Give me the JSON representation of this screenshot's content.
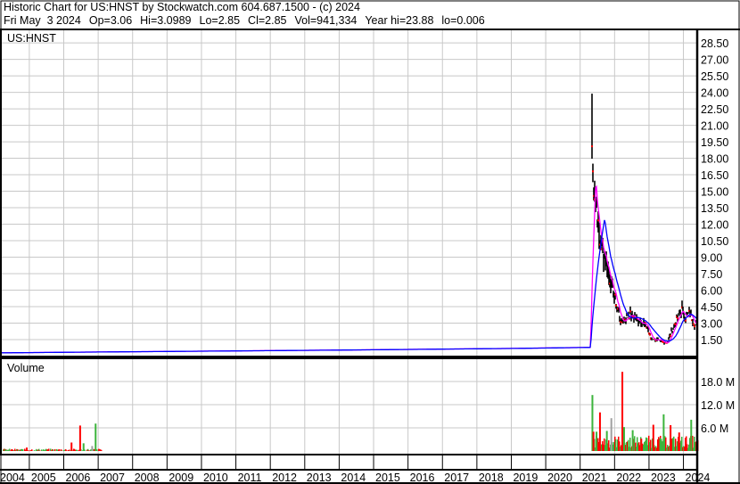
{
  "header": {
    "title": "Historic Chart for US:HNST by Stockwatch.com 604.687.1500 - (c) 2024",
    "date": "Fri May  3 2024",
    "open": "Op=3.06",
    "high": "Hi=3.0989",
    "low": "Lo=2.85",
    "close": "Cl=2.85",
    "volume": "Vol=941,334",
    "year_high": "Year hi=23.88",
    "year_low": "lo=0.006"
  },
  "chart_data": {
    "type": "line",
    "title": "Historic Chart for US:HNST",
    "symbol_label": "US:HNST",
    "volume_label": "Volume",
    "x_ticks": [
      "2004",
      "2005",
      "2006",
      "2007",
      "2008",
      "2009",
      "2010",
      "2011",
      "2012",
      "2013",
      "2014",
      "2015",
      "2016",
      "2017",
      "2018",
      "2019",
      "2020",
      "2021",
      "2022",
      "2023",
      "2024"
    ],
    "xlim": [
      2004.2,
      2024.4
    ],
    "price_ticks": [
      "1.50",
      "3.00",
      "4.50",
      "6.00",
      "7.50",
      "9.00",
      "10.50",
      "12.00",
      "13.50",
      "15.00",
      "16.50",
      "18.00",
      "19.50",
      "21.00",
      "22.50",
      "24.00",
      "25.50",
      "27.00",
      "28.50"
    ],
    "price_ylim": [
      0,
      29.5
    ],
    "volume_ticks": [
      "6.0 M",
      "12.0 M",
      "18.0 M"
    ],
    "volume_ylim_millions": [
      0,
      24
    ],
    "colors": {
      "price_bar": "#000000",
      "price_mark": "#ff0000",
      "ma_short": "#ff00ff",
      "ma_long": "#0000ff",
      "vol_up": "#3cb43c",
      "vol_down": "#ff0000",
      "vol_flat": "#a0a0a0",
      "grid": "#c8c8c8"
    },
    "price_close_series": [
      [
        2004.2,
        0.3
      ],
      [
        2006,
        0.35
      ],
      [
        2008,
        0.4
      ],
      [
        2010,
        0.45
      ],
      [
        2014,
        0.55
      ],
      [
        2019,
        0.7
      ],
      [
        2021.3,
        0.8
      ],
      [
        2021.33,
        21
      ],
      [
        2021.36,
        17
      ],
      [
        2021.4,
        15.5
      ],
      [
        2021.48,
        13.5
      ],
      [
        2021.55,
        10.5
      ],
      [
        2021.62,
        10
      ],
      [
        2021.75,
        8.5
      ],
      [
        2021.9,
        6.5
      ],
      [
        2022.05,
        4.8
      ],
      [
        2022.2,
        3.0
      ],
      [
        2022.3,
        3.4
      ],
      [
        2022.45,
        3.8
      ],
      [
        2022.6,
        3.4
      ],
      [
        2022.8,
        3.1
      ],
      [
        2022.95,
        2.6
      ],
      [
        2023.05,
        1.6
      ],
      [
        2023.3,
        1.4
      ],
      [
        2023.45,
        1.2
      ],
      [
        2023.55,
        1.3
      ],
      [
        2023.7,
        2.6
      ],
      [
        2023.85,
        3.6
      ],
      [
        2023.95,
        4.3
      ],
      [
        2024.05,
        3.4
      ],
      [
        2024.18,
        3.9
      ],
      [
        2024.34,
        2.85
      ]
    ],
    "price_high": 23.88,
    "volume_millions": [
      [
        2004.3,
        0.3,
        "up"
      ],
      [
        2004.9,
        0.9,
        "down"
      ],
      [
        2005.5,
        0.4,
        "down"
      ],
      [
        2006.2,
        2.2,
        "down"
      ],
      [
        2006.45,
        6.6,
        "down"
      ],
      [
        2006.55,
        2.0,
        "up"
      ],
      [
        2006.8,
        1.3,
        "flat"
      ],
      [
        2006.9,
        7.1,
        "up"
      ],
      [
        2021.33,
        14.5,
        "up"
      ],
      [
        2021.36,
        5.0,
        "down"
      ],
      [
        2021.45,
        5.0,
        "up"
      ],
      [
        2021.55,
        10.0,
        "down"
      ],
      [
        2021.75,
        5.2,
        "up"
      ],
      [
        2021.88,
        8.5,
        "flat"
      ],
      [
        2022.2,
        20.5,
        "down"
      ],
      [
        2022.25,
        6.2,
        "up"
      ],
      [
        2022.5,
        5.4,
        "up"
      ],
      [
        2022.75,
        3.2,
        "down"
      ],
      [
        2023.1,
        6.8,
        "down"
      ],
      [
        2023.3,
        3.3,
        "up"
      ],
      [
        2023.4,
        9.5,
        "up"
      ],
      [
        2023.6,
        6.7,
        "down"
      ],
      [
        2023.85,
        4.8,
        "down"
      ],
      [
        2024.2,
        8.1,
        "up"
      ],
      [
        2024.3,
        2.3,
        "up"
      ]
    ]
  }
}
